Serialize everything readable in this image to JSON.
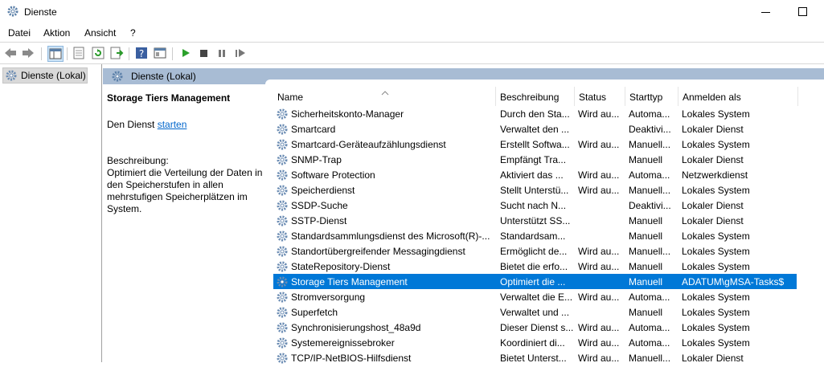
{
  "window": {
    "title": "Dienste"
  },
  "menu": [
    "Datei",
    "Aktion",
    "Ansicht",
    "?"
  ],
  "tree": {
    "item": "Dienste (Lokal)"
  },
  "pane": {
    "header": "Dienste (Lokal)"
  },
  "description": {
    "service_name": "Storage Tiers Management",
    "start_prefix": "Den Dienst ",
    "start_link": "starten",
    "label": "Beschreibung:",
    "text": "Optimiert die Verteilung der Daten in den Speicherstufen in allen mehrstufigen Speicherplätzen im System."
  },
  "columns": [
    "Name",
    "Beschreibung",
    "Status",
    "Starttyp",
    "Anmelden als"
  ],
  "rows": [
    {
      "name": "Sicherheitskonto-Manager",
      "desc": "Durch den Sta...",
      "status": "Wird au...",
      "start": "Automa...",
      "logon": "Lokales System"
    },
    {
      "name": "Smartcard",
      "desc": "Verwaltet den ...",
      "status": "",
      "start": "Deaktivi...",
      "logon": "Lokaler Dienst"
    },
    {
      "name": "Smartcard-Geräteaufzählungsdienst",
      "desc": "Erstellt Softwa...",
      "status": "Wird au...",
      "start": "Manuell...",
      "logon": "Lokales System"
    },
    {
      "name": "SNMP-Trap",
      "desc": "Empfängt Tra...",
      "status": "",
      "start": "Manuell",
      "logon": "Lokaler Dienst"
    },
    {
      "name": "Software Protection",
      "desc": "Aktiviert das ...",
      "status": "Wird au...",
      "start": "Automa...",
      "logon": "Netzwerkdienst"
    },
    {
      "name": "Speicherdienst",
      "desc": "Stellt Unterstü...",
      "status": "Wird au...",
      "start": "Manuell...",
      "logon": "Lokales System"
    },
    {
      "name": "SSDP-Suche",
      "desc": "Sucht nach N...",
      "status": "",
      "start": "Deaktivi...",
      "logon": "Lokaler Dienst"
    },
    {
      "name": "SSTP-Dienst",
      "desc": "Unterstützt SS...",
      "status": "",
      "start": "Manuell",
      "logon": "Lokaler Dienst"
    },
    {
      "name": "Standardsammlungsdienst des Microsoft(R)-...",
      "desc": "Standardsam...",
      "status": "",
      "start": "Manuell",
      "logon": "Lokales System"
    },
    {
      "name": "Standortübergreifender Messagingdienst",
      "desc": "Ermöglicht de...",
      "status": "Wird au...",
      "start": "Manuell...",
      "logon": "Lokales System"
    },
    {
      "name": "StateRepository-Dienst",
      "desc": "Bietet die erfo...",
      "status": "Wird au...",
      "start": "Manuell",
      "logon": "Lokales System"
    },
    {
      "name": "Storage Tiers Management",
      "desc": "Optimiert die ...",
      "status": "",
      "start": "Manuell",
      "logon": "ADATUM\\gMSA-Tasks$",
      "selected": true
    },
    {
      "name": "Stromversorgung",
      "desc": "Verwaltet die E...",
      "status": "Wird au...",
      "start": "Automa...",
      "logon": "Lokales System"
    },
    {
      "name": "Superfetch",
      "desc": "Verwaltet und ...",
      "status": "",
      "start": "Manuell",
      "logon": "Lokales System"
    },
    {
      "name": "Synchronisierungshost_48a9d",
      "desc": "Dieser Dienst s...",
      "status": "Wird au...",
      "start": "Automa...",
      "logon": "Lokales System"
    },
    {
      "name": "Systemereignissebroker",
      "desc": "Koordiniert di...",
      "status": "Wird au...",
      "start": "Automa...",
      "logon": "Lokales System"
    },
    {
      "name": "TCP/IP-NetBIOS-Hilfsdienst",
      "desc": "Bietet Unterst...",
      "status": "Wird au...",
      "start": "Manuell...",
      "logon": "Lokaler Dienst"
    }
  ],
  "colors": {
    "selection": "#0078d7",
    "pane_header": "#a8bcd4",
    "link": "#0066cc"
  }
}
